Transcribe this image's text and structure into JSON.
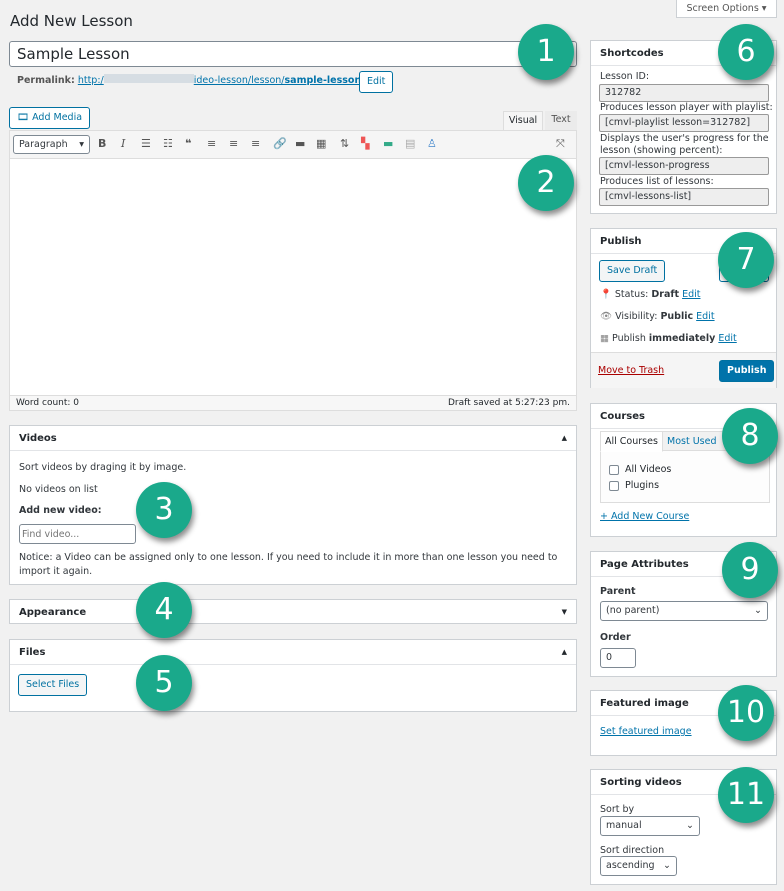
{
  "page": {
    "title": "Add New Lesson",
    "screen_options": "Screen Options ▾"
  },
  "post": {
    "title": "Sample Lesson",
    "permalink_label": "Permalink:",
    "permalink_start": "http:/",
    "permalink_end": "ideo-lesson/lesson/",
    "permalink_slug": "sample-lesson",
    "permalink_trailing": "/",
    "edit_label": "Edit"
  },
  "editor": {
    "add_media": "Add Media",
    "tab_visual": "Visual",
    "tab_text": "Text",
    "format": "Paragraph",
    "word_count": "Word count: 0",
    "draft_saved": "Draft saved at 5:27:23 pm."
  },
  "videos": {
    "title": "Videos",
    "sort_hint": "Sort videos by draging it by image.",
    "empty": "No videos on list",
    "add_label": "Add new video:",
    "find_placeholder": "Find video...",
    "notice": "Notice: a Video can be assigned only to one lesson. If you need to include it in more than one lesson you need to import it again."
  },
  "appearance": {
    "title": "Appearance"
  },
  "files": {
    "title": "Files",
    "select": "Select Files"
  },
  "shortcodes": {
    "title": "Shortcodes",
    "id_label": "Lesson ID:",
    "id_value": "312782",
    "playlist_label": "Produces lesson player with playlist:",
    "playlist_value": "[cmvl-playlist lesson=312782]",
    "progress_label": "Displays the user's progress for the lesson (showing percent):",
    "progress_value": "[cmvl-lesson-progress",
    "list_label": "Produces list of lessons:",
    "list_value": "[cmvl-lessons-list]"
  },
  "publish": {
    "title": "Publish",
    "save_draft": "Save Draft",
    "status_label": "Status:",
    "status_value": "Draft",
    "visibility_label": "Visibility:",
    "visibility_value": "Public",
    "publish_label": "Publish",
    "publish_value": "immediately",
    "edit": "Edit",
    "trash": "Move to Trash",
    "publish_button": "Publish"
  },
  "courses": {
    "title": "Courses",
    "tab_all": "All Courses",
    "tab_used": "Most Used",
    "items": [
      "All Videos",
      "Plugins"
    ],
    "add": "+ Add New Course"
  },
  "attributes": {
    "title": "Page Attributes",
    "parent_label": "Parent",
    "parent_value": "(no parent)",
    "order_label": "Order",
    "order_value": "0"
  },
  "featured": {
    "title": "Featured image",
    "set": "Set featured image"
  },
  "sorting": {
    "title": "Sorting videos",
    "sort_by_label": "Sort by",
    "sort_by_value": "manual",
    "direction_label": "Sort direction",
    "direction_value": "ascending"
  },
  "badges": [
    "1",
    "2",
    "3",
    "4",
    "5",
    "6",
    "7",
    "8",
    "9",
    "10",
    "11"
  ],
  "colors": {
    "accent": "#0073aa",
    "badge": "#1aa98b",
    "trash": "#a00"
  }
}
